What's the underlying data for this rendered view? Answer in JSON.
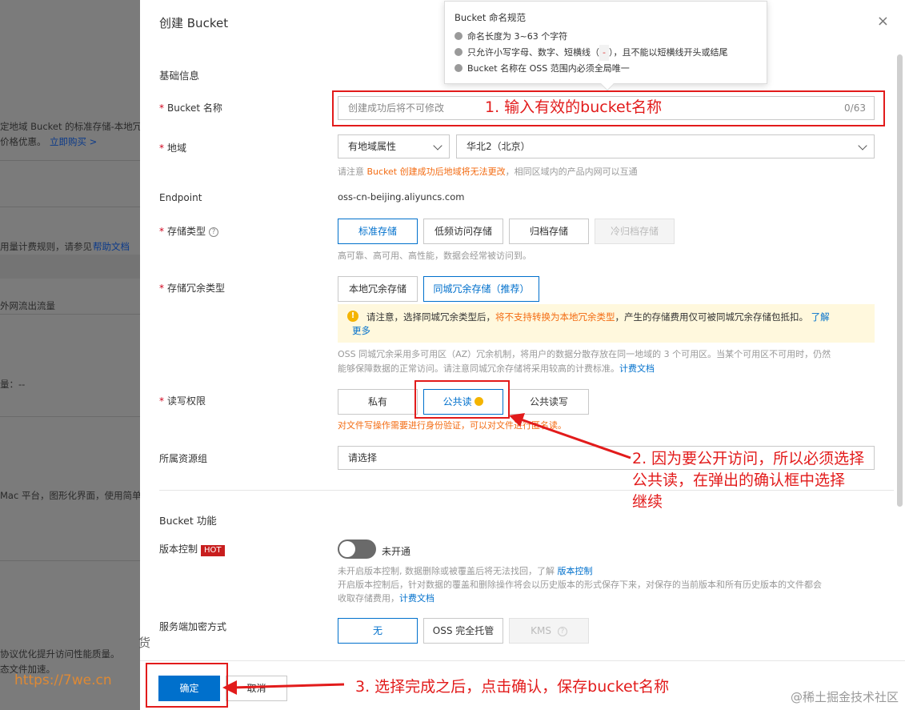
{
  "background": {
    "lines": [
      "定地域 Bucket 的标准存储-本地冗",
      "价格优惠。",
      "立即购买 >",
      "用量计费规则，请参见",
      "帮助文档",
      "外网流出流量",
      "量：--",
      "Mac 平台，图形化界面，使用简单",
      "协议优化提升访问性能质量。",
      "态文件加速。"
    ]
  },
  "drawer": {
    "title": "创建 Bucket",
    "close": "×"
  },
  "popover": {
    "title": "Bucket 命名规范",
    "items": [
      "命名长度为 3~63 个字符",
      "只允许小写字母、数字、短横线（",
      "），且不能以短横线开头或结尾",
      "Bucket 名称在 OSS 范围内必须全局唯一"
    ],
    "dash_code": "-"
  },
  "basic": {
    "section_title": "基础信息",
    "bucket_name": {
      "label": "Bucket 名称",
      "placeholder": "创建成功后将不可修改",
      "counter": "0/63"
    },
    "region": {
      "label": "地域",
      "attr_select": "有地域属性",
      "region_select": "华北2（北京）",
      "hint_prefix": "请注意 ",
      "hint_orange": "Bucket 创建成功后地域将无法更改",
      "hint_suffix": "，相同区域内的产品内网可以互通"
    },
    "endpoint": {
      "label": "Endpoint",
      "value": "oss-cn-beijing.aliyuncs.com"
    },
    "storage_class": {
      "label": "存储类型",
      "help": "?",
      "options": [
        "标准存储",
        "低频访问存储",
        "归档存储",
        "冷归档存储"
      ],
      "hint": "高可靠、高可用、高性能，数据会经常被访问到。"
    },
    "redundancy": {
      "label": "存储冗余类型",
      "options": [
        "本地冗余存储",
        "同城冗余存储（推荐）"
      ],
      "warn_icon": "!",
      "warn_prefix": "请注意，选择同城冗余类型后，",
      "warn_orange": "将不支持转换为本地冗余类型",
      "warn_suffix": "，产生的存储费用仅可被同城冗余存储包抵扣。",
      "warn_link1": "了解",
      "warn_link2": "更多",
      "desc1": "OSS 同城冗余采用多可用区（AZ）冗余机制，将用户的数据分散存放在同一地域的 3 个可用区。当某个可用区不可用时，仍然",
      "desc2": "能够保障数据的正常访问。请注意同城冗余存储将采用较高的计费标准。",
      "desc_link": "计费文档"
    },
    "acl": {
      "label": "读写权限",
      "options": [
        "私有",
        "公共读",
        "公共读写"
      ],
      "warn": "对文件写操作需要进行身份验证，可以对文件进行匿名读。"
    },
    "resource_group": {
      "label": "所属资源组",
      "placeholder": "请选择"
    }
  },
  "features": {
    "section_title": "Bucket 功能",
    "versioning": {
      "label": "版本控制",
      "hot": "HOT",
      "state": "未开通",
      "hint1_prefix": "未开启版本控制, 数据删除或被覆盖后将无法找回，了解 ",
      "hint1_link": "版本控制",
      "hint2": "开启版本控制后，针对数据的覆盖和删除操作将会以历史版本的形式保存下来，对保存的当前版本和所有历史版本的文件都会",
      "hint3_prefix": "收取存储费用，",
      "hint3_link": "计费文档"
    },
    "encryption": {
      "label": "服务端加密方式",
      "options": [
        "无",
        "OSS 完全托管",
        "KMS"
      ]
    }
  },
  "footer": {
    "confirm": "确定",
    "cancel": "取消"
  },
  "annotations": {
    "a1": "1. 输入有效的bucket名称",
    "a2_line1": "2. 因为要公开访问，所以必须选择",
    "a2_line2": "公共读，在弹出的确认框中选择",
    "a2_line3": "继续",
    "a3": "3. 选择完成之后，点击确认，保存bucket名称"
  },
  "watermarks": {
    "site": "https://7we.cn",
    "huo": "货",
    "juejin": "@稀土掘金技术社区"
  },
  "colors": {
    "primary": "#0070cc",
    "annotation_red": "#e21b1b",
    "warning_orange": "#f36b12"
  }
}
